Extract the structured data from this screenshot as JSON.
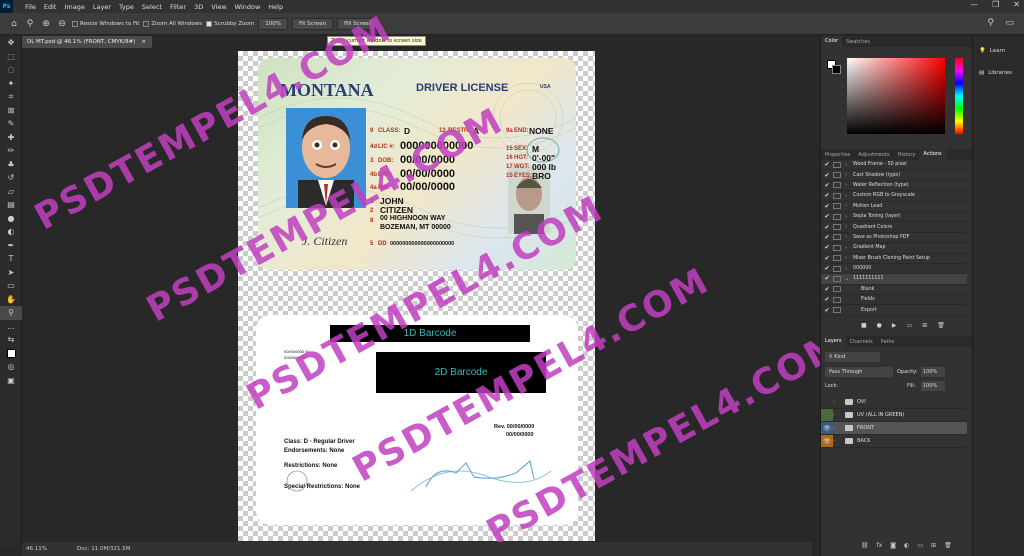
{
  "app": {
    "logo": "Ps",
    "menus": [
      "File",
      "Edit",
      "Image",
      "Layer",
      "Type",
      "Select",
      "Filter",
      "3D",
      "View",
      "Window",
      "Help"
    ],
    "window_controls": [
      "—",
      "❐",
      "✕"
    ]
  },
  "options": {
    "resize_label": "Resize Windows to Fit",
    "zoom_all_label": "Zoom All Windows",
    "scrubby_label": "Scrubby Zoom",
    "zoom_value": "100%",
    "fit_label": "Fit Screen",
    "fill_label": "Fill Screen",
    "tooltip": "Zoom current window to screen size"
  },
  "doc_tab": {
    "title": "DL MT.psd @ 46.1% (FRONT, CMYK/8#)",
    "close": "×"
  },
  "status": {
    "zoom": "46.11%",
    "doc": "Doc: 11.0M/321.5M"
  },
  "front": {
    "state": "MONTANA",
    "header": "DRIVER LICENSE",
    "country": "USA",
    "fields": [
      {
        "num": "9",
        "label": "CLASS:",
        "value": "D"
      },
      {
        "num": "9a",
        "label": "END:",
        "value": "NONE"
      },
      {
        "num": "12",
        "label": "RESTR:",
        "value": "A"
      },
      {
        "num": "4d",
        "label": "LIC #:",
        "value": "000000000000"
      },
      {
        "num": "3",
        "label": "DOB:",
        "value": "00/00/0000"
      },
      {
        "num": "4b",
        "label": "EXP:",
        "value": "00/00/0000"
      },
      {
        "num": "4a",
        "label": "ISS:",
        "value": "00/00/0000"
      },
      {
        "num": "15",
        "label": "SEX:",
        "value": "M"
      },
      {
        "num": "16",
        "label": "HGT:",
        "value": "0'-00\""
      },
      {
        "num": "17",
        "label": "WGT:",
        "value": "000 lb"
      },
      {
        "num": "15",
        "label": "EYES:",
        "value": "BRO"
      }
    ],
    "name1": "JOHN",
    "name2": "CITIZEN",
    "addr1": "00 HIGHNOON WAY",
    "addr2": "BOZEMAN, MT 00000",
    "dd": "000000000000000000000",
    "dd_num": "5",
    "dd_label": "DD",
    "sig": "J. Citizen",
    "n1": "1",
    "n2": "2",
    "n8": "8"
  },
  "back": {
    "barcode1": "1D Barcode",
    "barcode2": "2D Barcode",
    "small1": "00/00/0000 00",
    "small2": "0000000000",
    "rev": "Rev. 00/00/0000",
    "rev2": "00/00/0000",
    "class": "Class: D - Regular Driver",
    "endorse": "Endorsements: None",
    "restr": "Restrictions: None",
    "special": "Special Restrictions: None"
  },
  "watermark": "PSDTEMPEL4.COM",
  "panels": {
    "color_tabs": [
      "Color",
      "Swatches"
    ],
    "action_tabs": [
      "Properties",
      "Adjustments",
      "History",
      "Actions"
    ],
    "actions": [
      "Wood Frame - 50 pixel",
      "Cast Shadow (type)",
      "Water Reflection (type)",
      "Custom RGB to Grayscale",
      "Molten Lead",
      "Sepia Toning (layer)",
      "Quadrant Colors",
      "Save as Photoshop PDF",
      "Gradient Map",
      "Mixer Brush Cloning Paint Setup",
      "000000",
      "1111111111",
      "Blank",
      "Fields",
      "Export"
    ],
    "layer_tabs": [
      "Layers",
      "Channels",
      "Paths"
    ],
    "kind": "Kind",
    "blend": "Pass Through",
    "opacity_label": "Opacity:",
    "opacity": "100%",
    "lock_label": "Lock:",
    "fill_label": "Fill:",
    "fill": "100%",
    "layers": [
      "OVI",
      "UV (ALL IN GREEN)",
      "FRONT",
      "BACK"
    ],
    "right": [
      "Learn",
      "Libraries"
    ]
  },
  "colors": {
    "accent": "#c040c0",
    "header_blue": "#2a3b78",
    "label_red": "#b03020"
  }
}
